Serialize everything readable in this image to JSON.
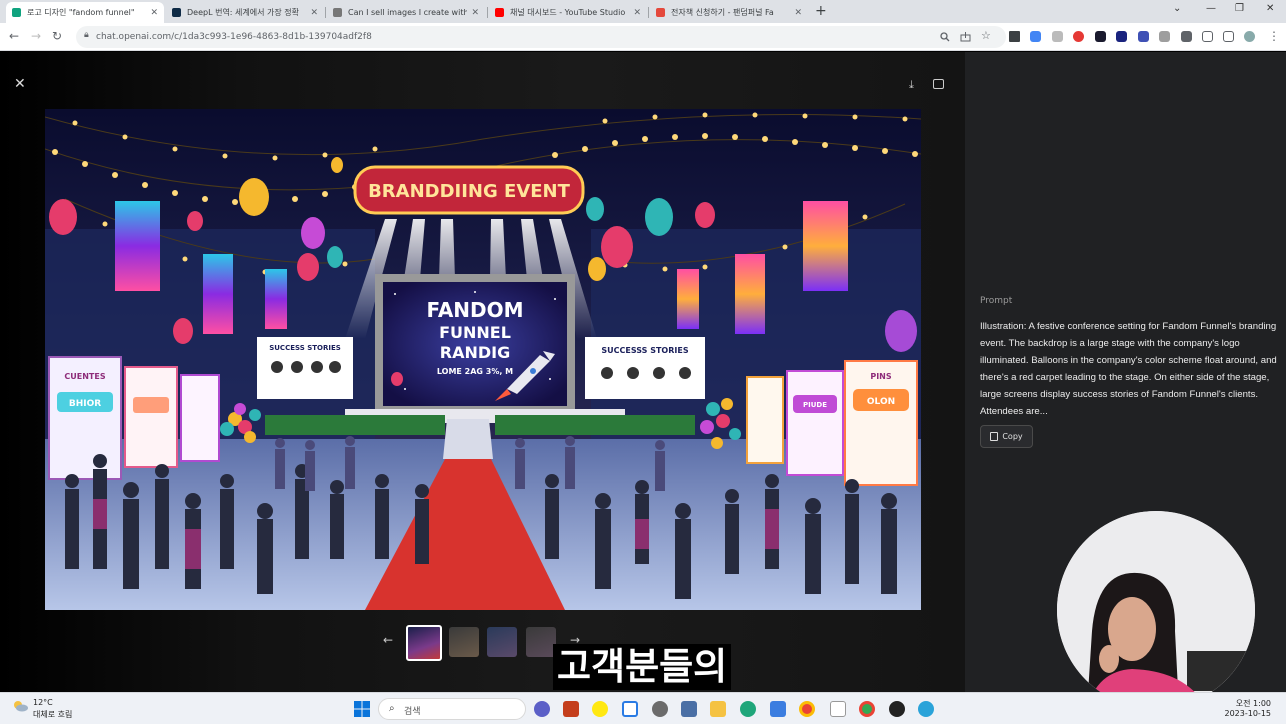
{
  "browser": {
    "tabs": [
      {
        "title": "로고 디자인 \"fandom funnel\"",
        "active": true,
        "color": "#10a37f"
      },
      {
        "title": "DeepL 번역: 세계에서 가장 정확",
        "active": false,
        "color": "#0f2b46"
      },
      {
        "title": "Can I sell images I create with",
        "active": false,
        "color": "#777777"
      },
      {
        "title": "채널 대시보드 - YouTube Studio",
        "active": false,
        "color": "#ff0000"
      },
      {
        "title": "전자책 신청하기 - 팬덤퍼널 Fa",
        "active": false,
        "color": "#e4483c"
      }
    ],
    "url": "chat.openai.com/c/1da3c993-1e96-4863-8d1b-139704adf2f8"
  },
  "viewer": {
    "main_image_alt": "",
    "image_texts": {
      "banner": "BRANDDIING EVENT",
      "screen_line1": "FANDOM",
      "screen_line2": "FUNNEL",
      "screen_line3": "RANDIG",
      "screen_line4": "LOME 2AG 3%, M",
      "left_board": "SUCCESS STORIES",
      "right_board": "SUCCESSS STORIES",
      "left_banner_title": "CUENTES",
      "left_banner_btn": "BHIOR",
      "right_banner_title": "PINS",
      "right_banner_btn": "OLON",
      "right_mid_btn": "PIUDE"
    },
    "thumbnail_count": 4,
    "selected_thumbnail": 1
  },
  "subtitle": "고객분들의",
  "panel": {
    "label": "Prompt",
    "text": "Illustration: A festive conference setting for Fandom Funnel's branding event. The backdrop is a large stage with the company's logo illuminated. Balloons in the company's color scheme float around, and there's a red carpet leading to the stage. On either side of the stage, large screens display success stories of Fandom Funnel's clients. Attendees are...",
    "copy_label": "Copy"
  },
  "taskbar": {
    "temp": "12°C",
    "weather": "대체로 흐림",
    "search_placeholder": "검색",
    "time": "오전 1:00",
    "date": "2023-10-15"
  }
}
